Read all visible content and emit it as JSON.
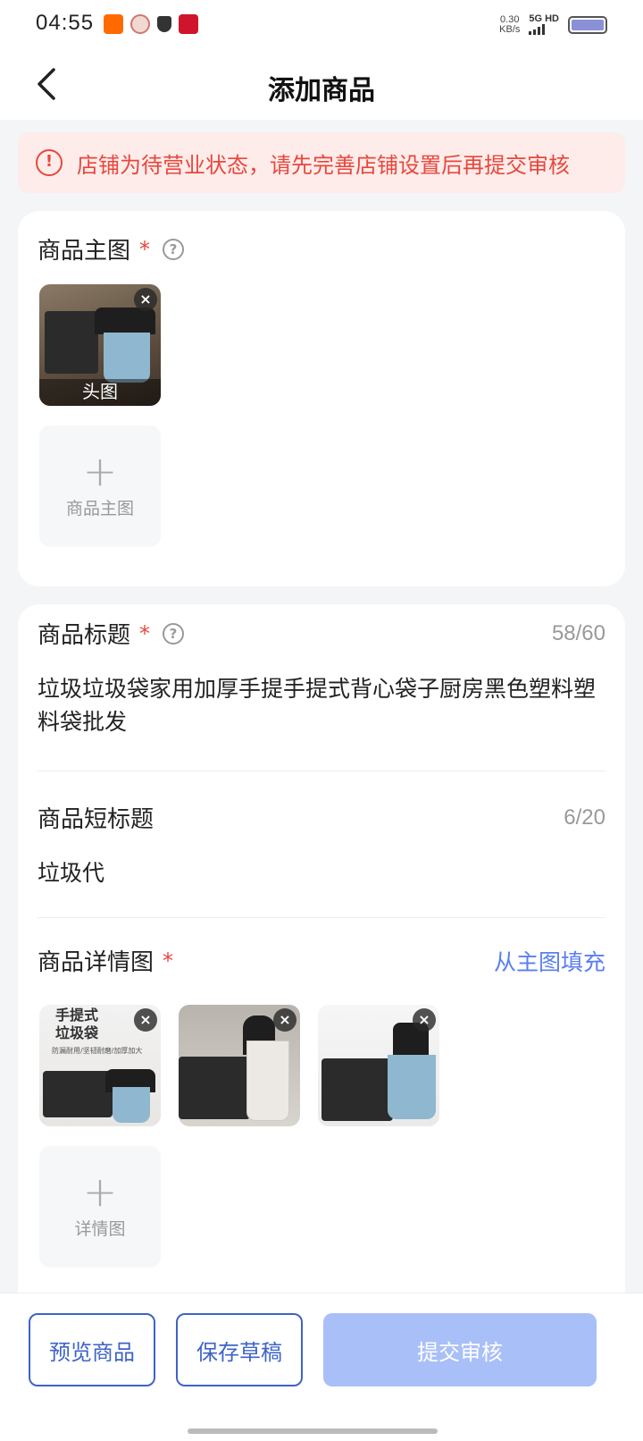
{
  "status_bar": {
    "time": "04:55",
    "net_speed_value": "0.30",
    "net_speed_unit": "KB/s",
    "network": "5G HD",
    "battery_level_fraction": 1.0
  },
  "nav": {
    "title": "添加商品"
  },
  "warning": {
    "text": "店铺为待营业状态，请先完善店铺设置后再提交审核"
  },
  "main_image": {
    "label": "商品主图",
    "required_mark": "*",
    "help_symbol": "?",
    "photo_caption": "头图",
    "add_label": "商品主图",
    "add_symbol": "+",
    "delete_symbol": "×"
  },
  "product_title": {
    "label": "商品标题",
    "required_mark": "*",
    "help_symbol": "?",
    "counter": "58/60",
    "value": "垃圾垃圾袋家用加厚手提手提式背心袋子厨房黑色塑料塑料袋批发"
  },
  "short_title": {
    "label": "商品短标题",
    "counter": "6/20",
    "value": "垃圾代"
  },
  "detail_images": {
    "label": "商品详情图",
    "required_mark": "*",
    "fill_link": "从主图填充",
    "photo1_title_line1": "手提式",
    "photo1_title_line2": "垃圾袋",
    "photo1_subtitle": "防漏耐用/坚韧耐磨/加厚加大",
    "add_label": "详情图",
    "add_symbol": "+",
    "delete_symbol": "×"
  },
  "bottom_bar": {
    "preview_label": "预览商品",
    "save_draft_label": "保存草稿",
    "submit_label": "提交审核"
  },
  "colors": {
    "accent": "#3e63c9",
    "link": "#5b7ef0",
    "warning": "#e8473c",
    "submit_disabled": "#a9bff7"
  }
}
